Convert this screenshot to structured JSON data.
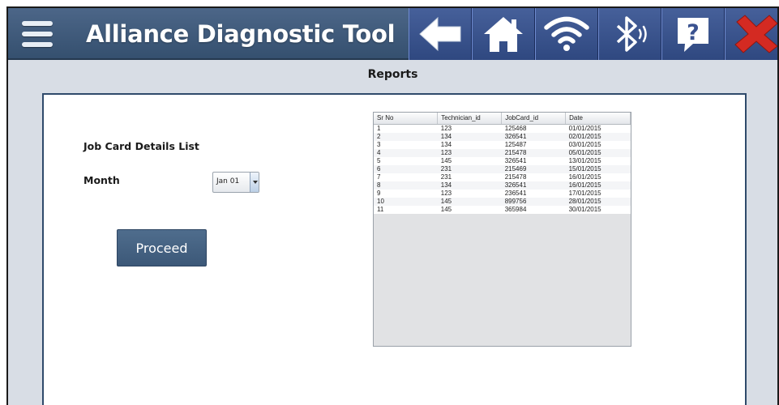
{
  "header": {
    "title": "Alliance Diagnostic Tool",
    "icons": [
      "menu-icon",
      "back-arrow-icon",
      "home-icon",
      "wifi-icon",
      "bluetooth-icon",
      "help-icon",
      "close-icon"
    ]
  },
  "page": {
    "title": "Reports"
  },
  "form": {
    "list_label": "Job Card Details List",
    "month_label": "Month",
    "month_value": "Jan 01",
    "proceed_label": "Proceed"
  },
  "table": {
    "headers": [
      "Sr No",
      "Technician_id",
      "JobCard_id",
      "Date"
    ],
    "rows": [
      [
        "1",
        "123",
        "125468",
        "01/01/2015"
      ],
      [
        "2",
        "134",
        "326541",
        "02/01/2015"
      ],
      [
        "3",
        "134",
        "125487",
        "03/01/2015"
      ],
      [
        "4",
        "123",
        "215478",
        "05/01/2015"
      ],
      [
        "5",
        "145",
        "326541",
        "13/01/2015"
      ],
      [
        "6",
        "231",
        "215469",
        "15/01/2015"
      ],
      [
        "7",
        "231",
        "215478",
        "16/01/2015"
      ],
      [
        "8",
        "134",
        "326541",
        "16/01/2015"
      ],
      [
        "9",
        "123",
        "236541",
        "17/01/2015"
      ],
      [
        "10",
        "145",
        "899756",
        "28/01/2015"
      ],
      [
        "11",
        "145",
        "365984",
        "30/01/2015"
      ]
    ]
  },
  "colors": {
    "header_bg": "#3f5a7c",
    "toolbar_bg": "#3a5290",
    "accent": "#4a6888",
    "close_red": "#d42a22"
  }
}
